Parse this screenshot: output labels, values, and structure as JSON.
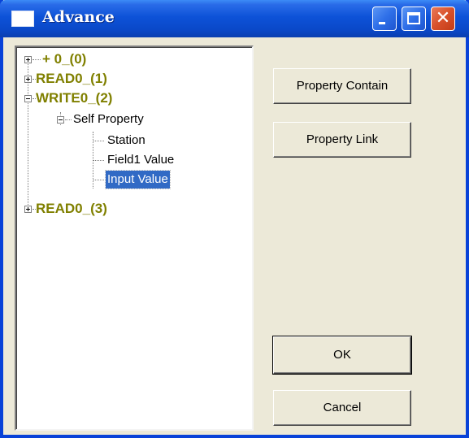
{
  "window": {
    "title": "Advance",
    "icon": "window-icon",
    "controls": {
      "minimize_icon": "minimize-icon",
      "maximize_icon": "maximize-icon",
      "close_icon": "close-icon",
      "close_glyph": "✕"
    },
    "colors": {
      "titlebar": "#0a48c8",
      "face": "#ece9d8",
      "tree_top_level": "#808000",
      "selection": "#316ac5"
    }
  },
  "tree": {
    "nodes": [
      {
        "label": "+ 0_(0)",
        "expander": "plus"
      },
      {
        "label": "READ0_(1)",
        "expander": "plus"
      },
      {
        "label": "WRITE0_(2)",
        "expander": "minus"
      },
      {
        "label": "Self Property",
        "expander": "minus"
      },
      {
        "label": "Station"
      },
      {
        "label": "Field1 Value"
      },
      {
        "label": "Input Value",
        "selected": true
      },
      {
        "label": "READ0_(3)",
        "expander": "plus"
      }
    ]
  },
  "buttons": {
    "property_contain": "Property Contain",
    "property_link": "Property Link",
    "ok": "OK",
    "cancel": "Cancel"
  }
}
